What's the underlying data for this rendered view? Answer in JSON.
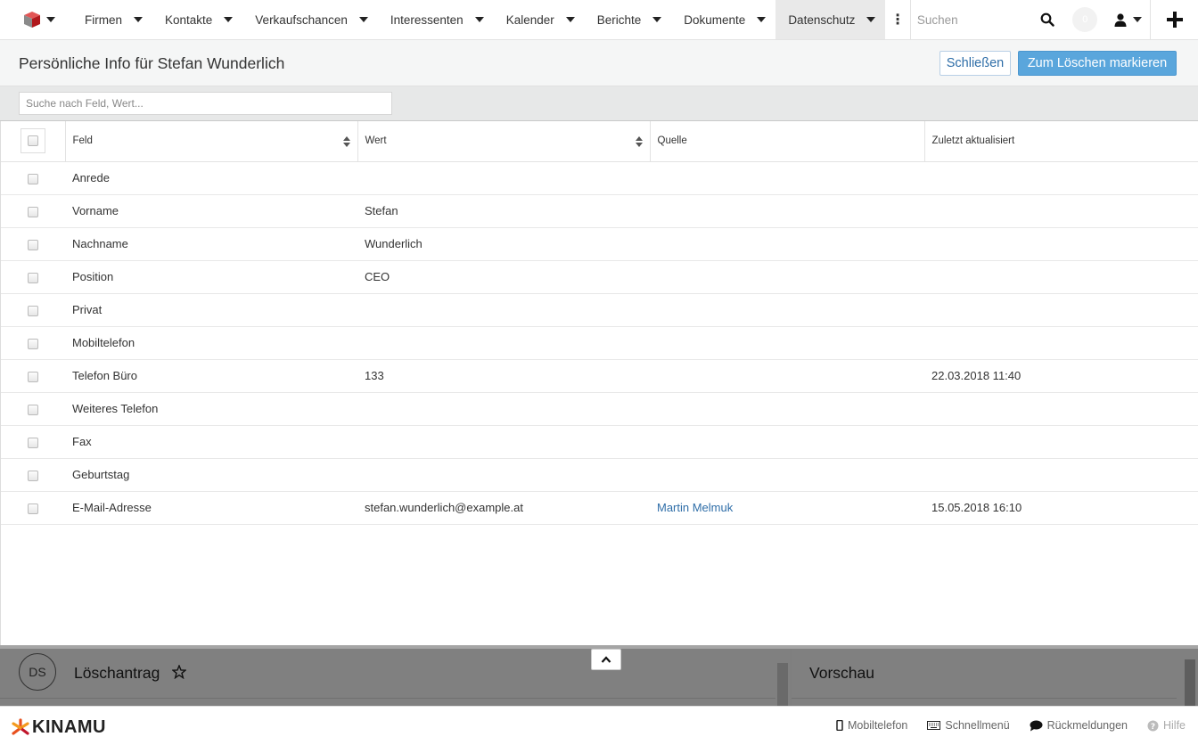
{
  "nav": {
    "items": [
      {
        "label": "Firmen"
      },
      {
        "label": "Kontakte"
      },
      {
        "label": "Verkaufschancen"
      },
      {
        "label": "Interessenten"
      },
      {
        "label": "Kalender"
      },
      {
        "label": "Berichte"
      },
      {
        "label": "Dokumente"
      },
      {
        "label": "Datenschutz",
        "active": true
      }
    ],
    "search_placeholder": "Suchen",
    "notification_count": "0"
  },
  "header": {
    "title": "Persönliche Info für Stefan Wunderlich",
    "close_label": "Schließen",
    "mark_label": "Zum Löschen markieren"
  },
  "filter": {
    "placeholder": "Suche nach Feld, Wert..."
  },
  "table": {
    "columns": [
      "Feld",
      "Wert",
      "Quelle",
      "Zuletzt aktualisiert"
    ],
    "rows": [
      {
        "field": "Anrede",
        "value": "",
        "source": "",
        "updated": ""
      },
      {
        "field": "Vorname",
        "value": "Stefan",
        "source": "",
        "updated": ""
      },
      {
        "field": "Nachname",
        "value": "Wunderlich",
        "source": "",
        "updated": ""
      },
      {
        "field": "Position",
        "value": "CEO",
        "source": "",
        "updated": ""
      },
      {
        "field": "Privat",
        "value": "",
        "source": "",
        "updated": ""
      },
      {
        "field": "Mobiltelefon",
        "value": "",
        "source": "",
        "updated": ""
      },
      {
        "field": "Telefon Büro",
        "value": "133",
        "source": "",
        "updated": "22.03.2018 11:40"
      },
      {
        "field": "Weiteres Telefon",
        "value": "",
        "source": "",
        "updated": ""
      },
      {
        "field": "Fax",
        "value": "",
        "source": "",
        "updated": ""
      },
      {
        "field": "Geburtstag",
        "value": "",
        "source": "",
        "updated": ""
      },
      {
        "field": "E-Mail-Adresse",
        "value": "stefan.wunderlich@example.at",
        "source": "Martin Melmuk",
        "updated": "15.05.2018 16:10"
      }
    ]
  },
  "panels": {
    "left": {
      "avatar": "DS",
      "title": "Löschantrag"
    },
    "right": {
      "title": "Vorschau"
    }
  },
  "footer": {
    "brand": "KINAMU",
    "links": {
      "mobile": "Mobiltelefon",
      "quickmenu": "Schnellmenü",
      "feedback": "Rückmeldungen",
      "help": "Hilfe"
    }
  },
  "colors": {
    "accent": "#5aa6dc",
    "link": "#2f6ea8",
    "brand_orange": "#e8501e"
  }
}
